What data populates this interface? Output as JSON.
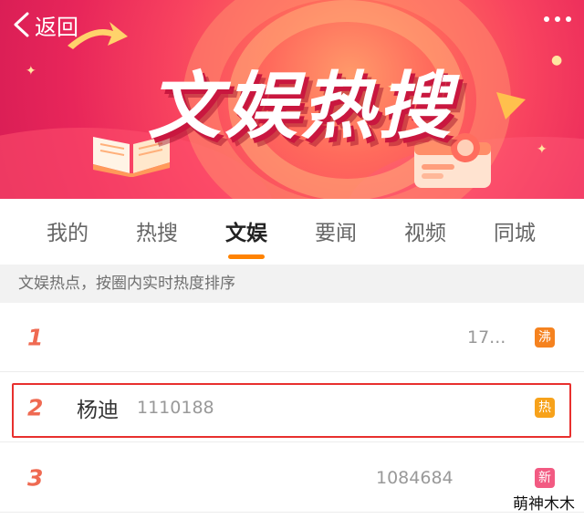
{
  "header": {
    "back_label": "返回",
    "banner_title": "文娱热搜"
  },
  "tabs": [
    {
      "label": "我的",
      "active": false
    },
    {
      "label": "热搜",
      "active": false
    },
    {
      "label": "文娱",
      "active": true
    },
    {
      "label": "要闻",
      "active": false
    },
    {
      "label": "视频",
      "active": false
    },
    {
      "label": "同城",
      "active": false
    }
  ],
  "subheader": "文娱热点，按圈内实时热度排序",
  "list": [
    {
      "rank": "1",
      "keyword": "",
      "count": "17...",
      "badge": "沸",
      "badge_color": "#f5821f"
    },
    {
      "rank": "2",
      "keyword": "杨迪",
      "count": "1110188",
      "badge": "热",
      "badge_color": "#f7a21b"
    },
    {
      "rank": "3",
      "keyword": "",
      "count": "1084684",
      "badge": "新",
      "badge_color": "#f25a82"
    }
  ],
  "watermark": "萌神木木",
  "colors": {
    "accent_orange": "#ff8200",
    "rank_color": "#ef6a52",
    "highlight_border": "#e8302e"
  }
}
